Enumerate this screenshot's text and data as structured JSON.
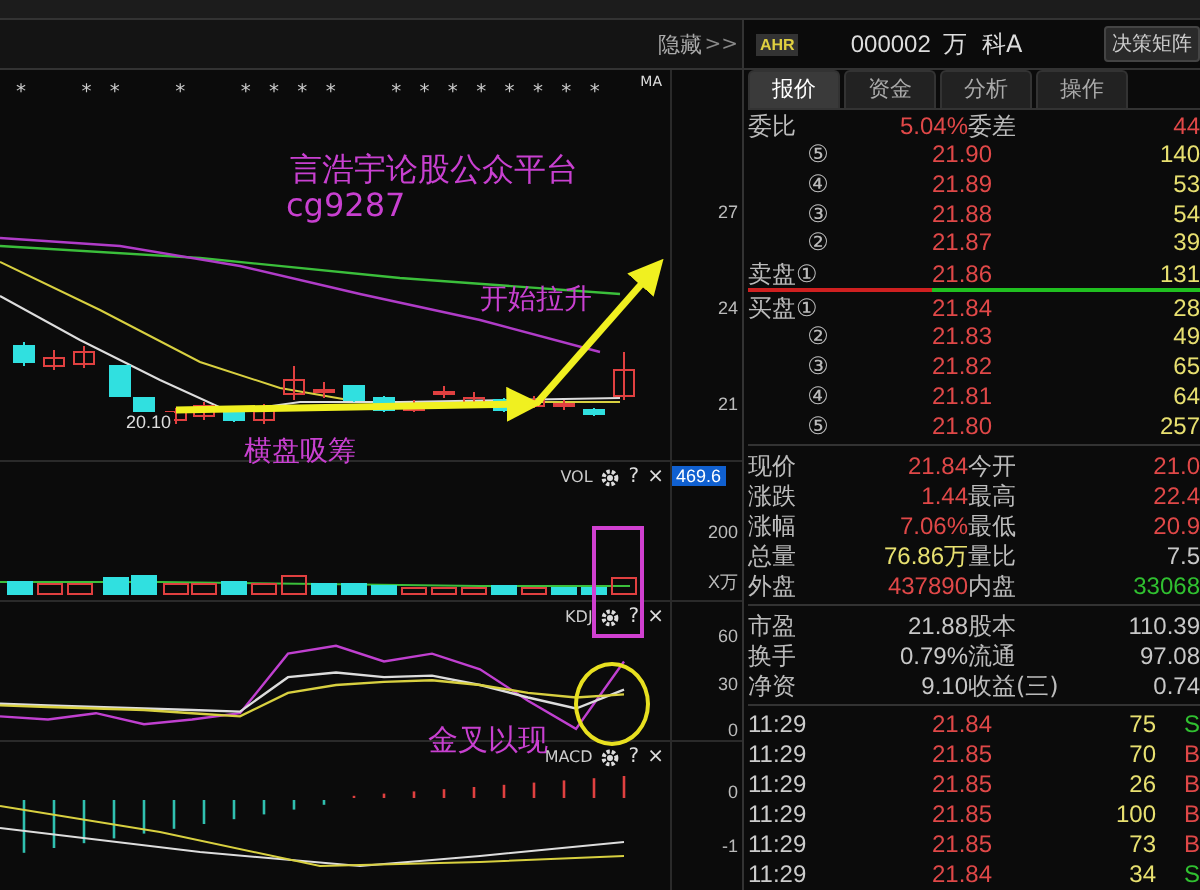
{
  "chart_header": {
    "hide_label": "隐藏",
    "hide_arrow": ">>"
  },
  "quote_header": {
    "badge": "AHR",
    "code": "000002",
    "name": "万  科A",
    "button": "决策矩阵"
  },
  "main_chart": {
    "indicator": "MA",
    "markers": "*    * *    *    * * * *    * * * * * * * *",
    "axis_labels": [
      "27",
      "24",
      "21"
    ],
    "low_label": "20.10",
    "annotations": [
      {
        "kind": "title",
        "text": "言浩宇论股公众平台"
      },
      {
        "kind": "title",
        "text": "cg9287"
      },
      {
        "kind": "note",
        "text": "开始拉升"
      },
      {
        "kind": "note",
        "text": "横盘吸筹"
      }
    ]
  },
  "vol_panel": {
    "name": "VOL",
    "help": "?",
    "close": "×",
    "current": "469.6",
    "axis_labels": [
      "200",
      "X万"
    ]
  },
  "kdj_panel": {
    "name": "KDJ",
    "help": "?",
    "close": "×",
    "annotation": "金叉以现",
    "chart_data": {
      "type": "line",
      "ylim": [
        0,
        60
      ],
      "yticks": [
        0,
        30,
        60
      ],
      "series": [
        {
          "color": "#c040d0",
          "values": [
            10,
            8,
            12,
            5,
            8,
            12,
            50,
            55,
            45,
            50,
            40,
            20,
            2,
            45
          ]
        },
        {
          "color": "#dddddd",
          "values": [
            18,
            17,
            16,
            15,
            14,
            13,
            35,
            38,
            35,
            36,
            30,
            22,
            15,
            27
          ]
        },
        {
          "color": "#d8d040",
          "values": [
            17,
            16,
            15,
            14,
            12,
            10,
            25,
            30,
            32,
            33,
            30,
            25,
            22,
            24
          ]
        }
      ]
    }
  },
  "macd_panel": {
    "name": "MACD",
    "help": "?",
    "close": "×",
    "axis_labels": [
      "0",
      "-1"
    ]
  },
  "tabs": [
    {
      "label": "报价",
      "selected": true
    },
    {
      "label": "资金",
      "selected": false
    },
    {
      "label": "分析",
      "selected": false
    },
    {
      "label": "操作",
      "selected": false
    }
  ],
  "order_ratio": {
    "label": "委比",
    "value": "5.04%",
    "diff_label": "委差",
    "diff": "44"
  },
  "sell_levels": [
    {
      "label": "⑤",
      "price": "21.90",
      "volume": "140"
    },
    {
      "label": "④",
      "price": "21.89",
      "volume": "53"
    },
    {
      "label": "③",
      "price": "21.88",
      "volume": "54"
    },
    {
      "label": "②",
      "price": "21.87",
      "volume": "39"
    },
    {
      "label": "卖盘①",
      "price": "21.86",
      "volume": "131"
    }
  ],
  "buy_levels": [
    {
      "label": "买盘①",
      "price": "21.84",
      "volume": "28"
    },
    {
      "label": "②",
      "price": "21.83",
      "volume": "49"
    },
    {
      "label": "③",
      "price": "21.82",
      "volume": "65"
    },
    {
      "label": "④",
      "price": "21.81",
      "volume": "64"
    },
    {
      "label": "⑤",
      "price": "21.80",
      "volume": "257"
    }
  ],
  "stats_a": [
    {
      "label": "现价",
      "value": "21.84",
      "kind": "up"
    },
    {
      "label": "今开",
      "value": "21.0",
      "kind": "up"
    },
    {
      "label": "涨跌",
      "value": "1.44",
      "kind": "up"
    },
    {
      "label": "最高",
      "value": "22.4",
      "kind": "up"
    },
    {
      "label": "涨幅",
      "value": "7.06%",
      "kind": "up"
    },
    {
      "label": "最低",
      "value": "20.9",
      "kind": "up"
    },
    {
      "label": "总量",
      "value": "76.86万",
      "kind": "volume"
    },
    {
      "label": "量比",
      "value": "7.5",
      "kind": "neutral"
    },
    {
      "label": "外盘",
      "value": "437890",
      "kind": "up"
    },
    {
      "label": "内盘",
      "value": "33068",
      "kind": "down"
    }
  ],
  "stats_b": [
    {
      "label": "市盈",
      "value": "21.88"
    },
    {
      "label": "股本",
      "value": "110.39"
    },
    {
      "label": "换手",
      "value": "0.79%"
    },
    {
      "label": "流通",
      "value": "97.08"
    },
    {
      "label": "净资",
      "value": "9.10"
    },
    {
      "label": "收益(三)",
      "value": "0.74"
    }
  ],
  "ticks": [
    {
      "time": "11:29",
      "price": "21.84",
      "volume": "75",
      "side": "S",
      "kind": "sell"
    },
    {
      "time": "11:29",
      "price": "21.85",
      "volume": "70",
      "side": "B",
      "kind": "buy"
    },
    {
      "time": "11:29",
      "price": "21.85",
      "volume": "26",
      "side": "B",
      "kind": "buy"
    },
    {
      "time": "11:29",
      "price": "21.85",
      "volume": "100",
      "side": "B",
      "kind": "buy"
    },
    {
      "time": "11:29",
      "price": "21.85",
      "volume": "73",
      "side": "B",
      "kind": "buy"
    },
    {
      "time": "11:29",
      "price": "21.84",
      "volume": "34",
      "side": "S",
      "kind": "sell"
    }
  ]
}
